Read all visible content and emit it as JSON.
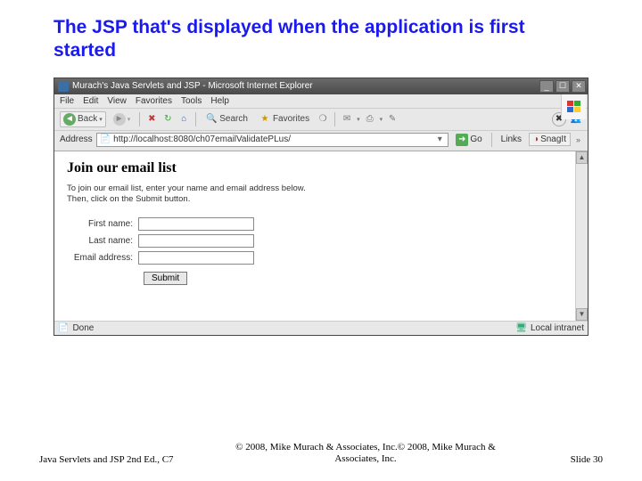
{
  "slide": {
    "title": "The JSP that's displayed when the application is first started"
  },
  "browser": {
    "title": "Murach's Java Servlets and JSP - Microsoft Internet Explorer",
    "menus": [
      "File",
      "Edit",
      "View",
      "Favorites",
      "Tools",
      "Help"
    ],
    "toolbar": {
      "back": "Back",
      "search": "Search",
      "favorites": "Favorites"
    },
    "address": {
      "label": "Address",
      "url": "http://localhost:8080/ch07emailValidatePLus/",
      "go": "Go",
      "links": "Links",
      "snagit": "SnagIt"
    },
    "status": {
      "left": "Done",
      "right": "Local intranet"
    }
  },
  "page": {
    "heading": "Join our email list",
    "intro1": "To join our email list, enter your name and email address below.",
    "intro2": "Then, click on the Submit button.",
    "labels": {
      "first": "First name:",
      "last": "Last name:",
      "email": "Email address:"
    },
    "submit": "Submit"
  },
  "footer": {
    "left": "Java Servlets and JSP 2nd Ed., C7",
    "mid": "© 2008, Mike Murach & Associates, Inc.© 2008, Mike Murach & Associates, Inc.",
    "right": "Slide 30"
  }
}
